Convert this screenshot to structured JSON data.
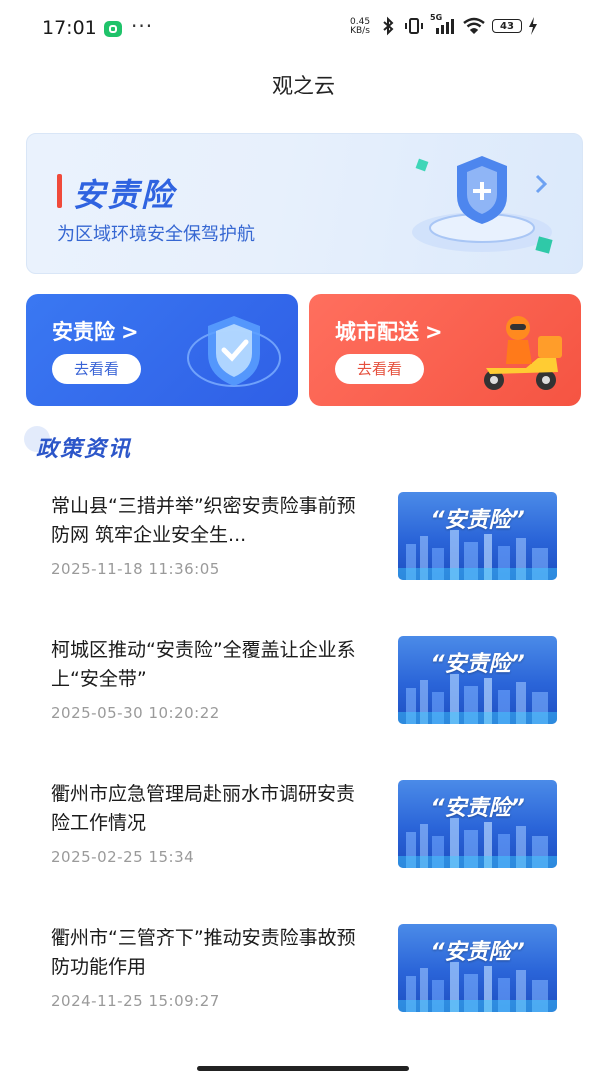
{
  "status": {
    "time": "17:01",
    "speed_value": "0.45",
    "speed_unit": "KB/s",
    "signal_label": "5G",
    "battery": "43"
  },
  "page": {
    "title": "观之云"
  },
  "hero": {
    "title": "安责险",
    "subtitle": "为区域环境安全保驾护航"
  },
  "cards": [
    {
      "title": "安责险",
      "chevron": ">",
      "button": "去看看"
    },
    {
      "title": "城市配送",
      "chevron": ">",
      "button": "去看看"
    }
  ],
  "section": {
    "title": "政策资讯"
  },
  "news": [
    {
      "title": "常山县“三措并举”织密安责险事前预防网 筑牢企业安全生...",
      "date": "2025-11-18 11:36:05",
      "thumb": "“安责险”"
    },
    {
      "title": "柯城区推动“安责险”全覆盖让企业系上“安全带”",
      "date": "2025-05-30 10:20:22",
      "thumb": "“安责险”"
    },
    {
      "title": "衢州市应急管理局赴丽水市调研安责险工作情况",
      "date": "2025-02-25 15:34",
      "thumb": "“安责险”"
    },
    {
      "title": "衢州市“三管齐下”推动安责险事故预防功能作用",
      "date": "2024-11-25 15:09:27",
      "thumb": "“安责险”"
    }
  ],
  "colors": {
    "accent_blue": "#3a78f2",
    "accent_red": "#f55442",
    "title_blue": "#2f63e0"
  }
}
